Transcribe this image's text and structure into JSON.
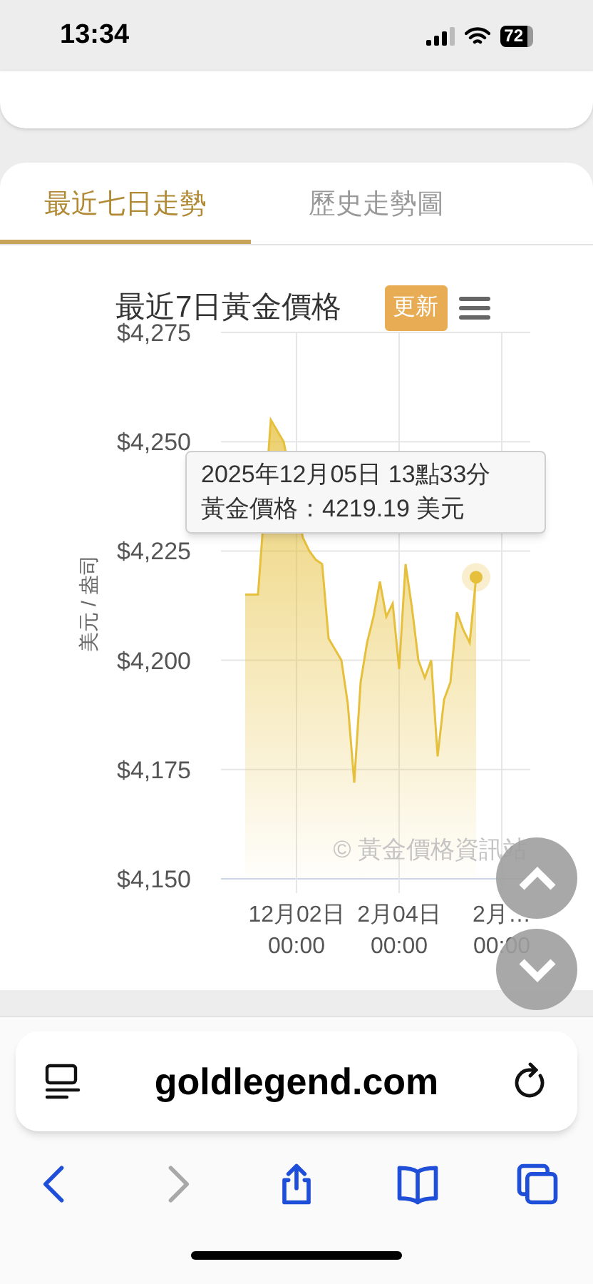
{
  "status_bar": {
    "time": "13:34",
    "battery": "72"
  },
  "tabs": [
    {
      "label": "最近七日走勢",
      "selected": true
    },
    {
      "label": "歷史走勢圖",
      "selected": false
    }
  ],
  "chart": {
    "title": "最近7日黃金價格",
    "refresh_button": "更新",
    "credits": "© 黃金價格資訊站",
    "tooltip": {
      "line_1": "2025年12月05日 13點33分",
      "line_2": "黃金價格：4219.19 美元"
    },
    "chart_data": {
      "type": "area",
      "grid": true,
      "ylabel": "美元 / 盎司",
      "ylim": [
        4150,
        4275
      ],
      "yticks": [
        {
          "value": 4150,
          "label": "$4,150"
        },
        {
          "value": 4175,
          "label": "$4,175"
        },
        {
          "value": 4200,
          "label": "$4,200"
        },
        {
          "value": 4225,
          "label": "$4,225"
        },
        {
          "value": 4250,
          "label": "$4,250"
        },
        {
          "value": 4275,
          "label": "$4,275"
        }
      ],
      "categories": [
        null,
        null,
        null,
        null,
        null,
        null,
        null,
        null,
        "12月02日 00:00",
        null,
        null,
        null,
        null,
        null,
        null,
        null,
        null,
        null,
        null,
        null,
        null,
        null,
        null,
        null,
        "2月04日 00:00",
        null,
        null,
        null,
        null,
        null,
        null,
        null,
        null,
        null,
        null,
        null,
        null,
        null,
        null,
        null,
        "2月… 00:00"
      ],
      "series": [
        {
          "color": "#e6c03c",
          "values": [
            4215,
            4215,
            4215,
            null,
            4255,
            null,
            4250,
            null,
            null,
            4228,
            4225,
            4223,
            4222,
            4205,
            null,
            4200,
            4190,
            4172,
            4195,
            4204,
            4210,
            4218,
            4210,
            4213,
            4198,
            4222,
            4212,
            4200,
            4196,
            4200,
            4178,
            4191,
            4195,
            4211,
            4207,
            4204,
            4219,
            null,
            null,
            null,
            null
          ]
        }
      ]
    }
  },
  "address_bar": {
    "url": "goldlegend.com"
  },
  "toolbar": [
    {
      "kind": "back",
      "disabled": false
    },
    {
      "kind": "forward",
      "disabled": true
    },
    {
      "kind": "share",
      "disabled": false
    },
    {
      "kind": "bookmarks",
      "disabled": false
    },
    {
      "kind": "tabs",
      "disabled": false
    }
  ]
}
